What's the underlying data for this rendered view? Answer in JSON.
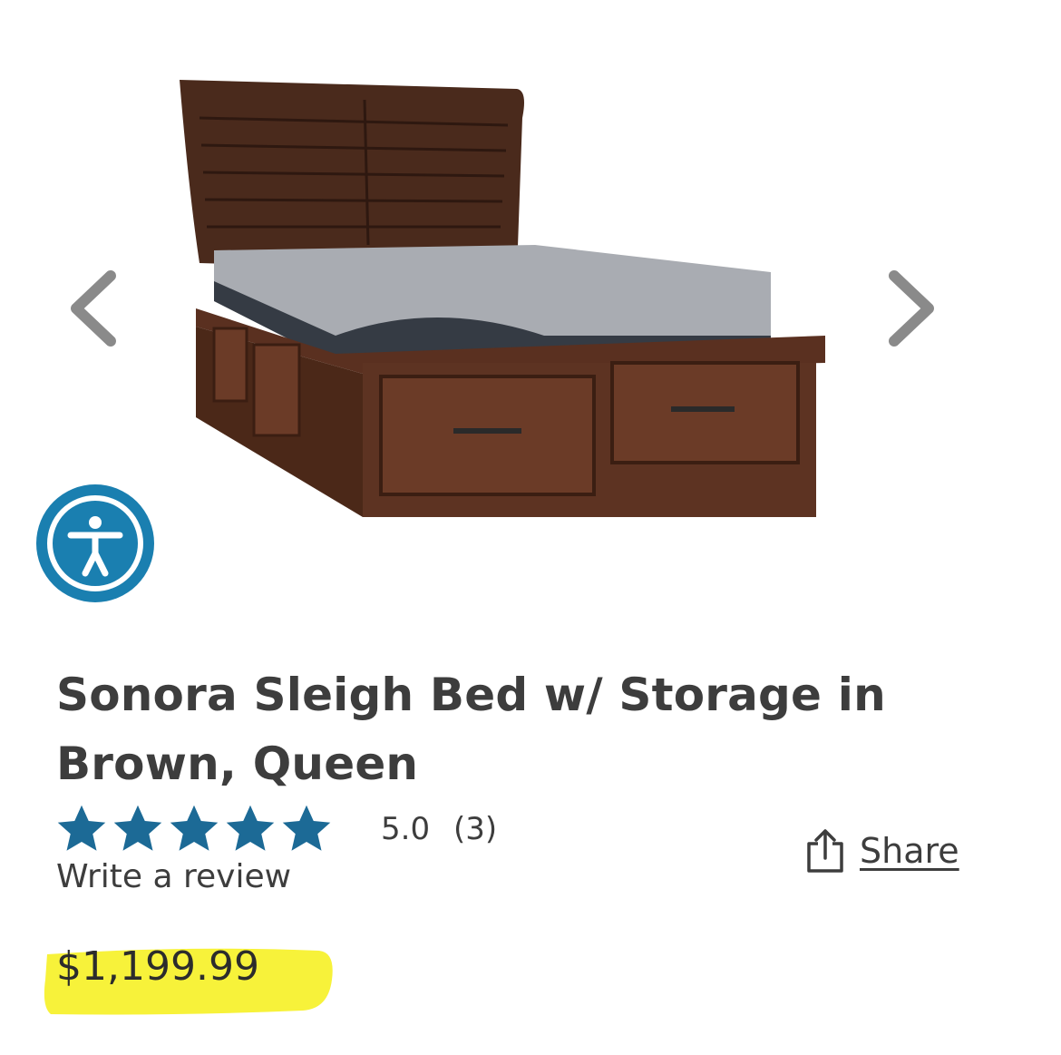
{
  "product": {
    "title": "Sonora Sleigh Bed w/ Storage in Brown, Queen",
    "rating_value": "5.0",
    "rating_count": "(3)",
    "rating_stars": 5,
    "write_review_label": "Write a review",
    "share_label": "Share",
    "price": "$1,199.99"
  },
  "gallery": {
    "prev_icon": "chevron-left-icon",
    "next_icon": "chevron-right-icon",
    "accessibility_icon": "accessibility-icon"
  },
  "colors": {
    "star": "#1c6a96",
    "accessibility": "#1a7fb0",
    "highlight": "#f7f23a",
    "text": "#3d3d3d",
    "arrow": "#888888"
  }
}
